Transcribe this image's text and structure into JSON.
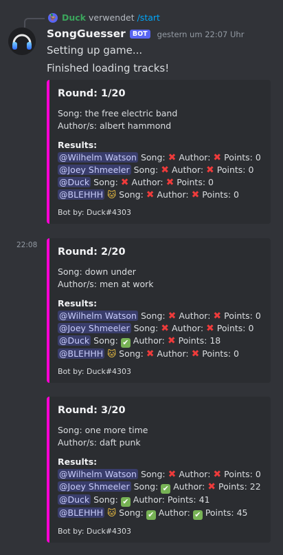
{
  "reply": {
    "username": "Duck",
    "action": "verwendet",
    "command": "/start"
  },
  "author": {
    "name": "SongGuesser",
    "badge": "BOT",
    "timestamp": "gestern um 22:07 Uhr"
  },
  "messages": [
    "Setting up game...",
    "Finished loading tracks!"
  ],
  "side_timestamp": "22:08",
  "labels": {
    "song": "Song:",
    "author": "Author:",
    "points": "Points:",
    "results": "Results:"
  },
  "accent_color": "#ff00d4",
  "icons": {
    "wrong": "cross-mark-icon",
    "correct": "check-mark-icon",
    "cat": "cat-face-icon"
  },
  "rounds": [
    {
      "title": "Round: 1/20",
      "song_line": "Song: the free electric band",
      "author_line": "Author/s: albert hammond",
      "footer": "Bot by: Duck#4303",
      "results": [
        {
          "mention": "@Wilhelm Watson",
          "song_correct": false,
          "author_correct": false,
          "points": "0"
        },
        {
          "mention": "@Joey Shmeeler",
          "song_correct": false,
          "author_correct": false,
          "points": "0"
        },
        {
          "mention": "@Duck",
          "song_correct": false,
          "author_correct": false,
          "points": "0"
        },
        {
          "mention": "@BLEHHH",
          "cat": true,
          "song_correct": false,
          "author_correct": false,
          "points": "0"
        }
      ]
    },
    {
      "title": "Round: 2/20",
      "song_line": "Song: down under",
      "author_line": "Author/s: men at work",
      "footer": "Bot by: Duck#4303",
      "results": [
        {
          "mention": "@Wilhelm Watson",
          "song_correct": false,
          "author_correct": false,
          "points": "0"
        },
        {
          "mention": "@Joey Shmeeler",
          "song_correct": false,
          "author_correct": false,
          "points": "0"
        },
        {
          "mention": "@Duck",
          "song_correct": true,
          "author_correct": false,
          "points": "18"
        },
        {
          "mention": "@BLEHHH",
          "cat": true,
          "song_correct": false,
          "author_correct": false,
          "points": "0"
        }
      ]
    },
    {
      "title": "Round: 3/20",
      "song_line": "Song: one more time",
      "author_line": "Author/s: daft punk",
      "footer": "Bot by: Duck#4303",
      "results": [
        {
          "mention": "@Wilhelm Watson",
          "song_correct": false,
          "author_correct": false,
          "points": "0"
        },
        {
          "mention": "@Joey Shmeeler",
          "song_correct": true,
          "author_correct": false,
          "points": "22"
        },
        {
          "mention": "@Duck",
          "song_correct": true,
          "author_correct": null,
          "points": "41"
        },
        {
          "mention": "@BLEHHH",
          "cat": true,
          "song_correct": true,
          "author_correct": true,
          "points": "45"
        }
      ]
    }
  ]
}
